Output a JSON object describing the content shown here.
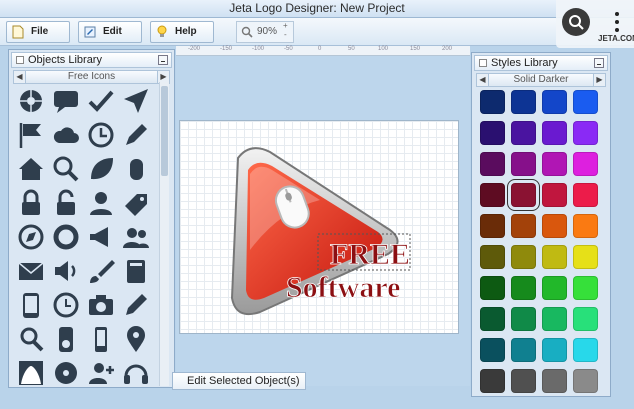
{
  "window": {
    "title": "Jeta Logo Designer: New Project"
  },
  "overlay": {
    "label": "JETA.COM"
  },
  "toolbar": {
    "file_label": "File",
    "edit_label": "Edit",
    "help_label": "Help",
    "zoom_value": "90%"
  },
  "ruler": {
    "ticks": [
      "-200",
      "-150",
      "-100",
      "-50",
      "0",
      "50",
      "100",
      "150",
      "200"
    ]
  },
  "objects_library": {
    "title": "Objects Library",
    "category": "Free Icons",
    "icons": [
      "aperture-icon",
      "speech-bubble-icon",
      "checkmark-icon",
      "send-arrow-icon",
      "flag-icon",
      "cloud-icon",
      "clock-icon",
      "pencil-icon",
      "home-icon",
      "search-icon",
      "leaf-icon",
      "mouse-icon",
      "padlock-icon",
      "unlock-icon",
      "user-icon",
      "tag-icon",
      "compass-icon",
      "lifebuoy-icon",
      "megaphone-icon",
      "users-icon",
      "envelope-icon",
      "speaker-icon",
      "brush-icon",
      "book-icon",
      "tablet-icon",
      "clock-outline-icon",
      "camera-icon",
      "pen-icon",
      "magnifier-icon",
      "ipod-icon",
      "phone-icon",
      "map-pin-icon",
      "shape-icon",
      "disc-icon",
      "user-add-icon",
      "headset-icon"
    ]
  },
  "canvas": {
    "logo_line1": "FREE",
    "logo_line2": "Software"
  },
  "edit_selected": {
    "label": "Edit Selected Object(s)"
  },
  "styles_library": {
    "title": "Styles Library",
    "category": "Solid Darker",
    "swatches": [
      [
        "#0d2a6e",
        "#0d3494",
        "#1346c9",
        "#1a5cf0"
      ],
      [
        "#2a1070",
        "#4a14a0",
        "#6a1ad0",
        "#8a2af5"
      ],
      [
        "#5a0c5e",
        "#86108a",
        "#b016b4",
        "#dd20df"
      ],
      [
        "#5e0c22",
        "#8a1232",
        "#c0163e",
        "#ec1c4a"
      ],
      [
        "#6a2c08",
        "#a3420a",
        "#d9570d",
        "#fa7a12"
      ],
      [
        "#5e5a0a",
        "#8f8a0c",
        "#c0ba12",
        "#e6e018"
      ],
      [
        "#0d5a12",
        "#168a1c",
        "#22b82a",
        "#36e03a"
      ],
      [
        "#0a5a30",
        "#108a48",
        "#18b860",
        "#28e07a"
      ],
      [
        "#0a505e",
        "#108090",
        "#18aec2",
        "#28d8ea"
      ],
      [
        "#3a3a3a",
        "#505050",
        "#6a6a6a",
        "#8a8a8a"
      ]
    ]
  }
}
